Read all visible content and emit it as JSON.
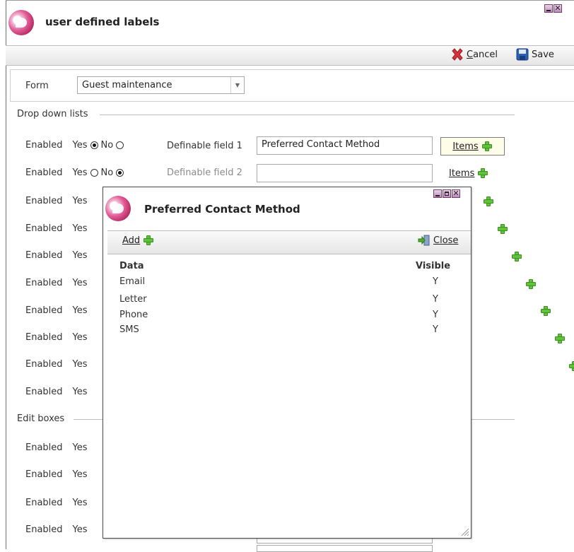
{
  "window": {
    "title": "user defined labels",
    "toolbar": {
      "cancel_label": "Cancel",
      "save_label": "Save"
    },
    "form_label": "Form",
    "form_value": "Guest maintenance",
    "section_dropdowns": "Drop down lists",
    "section_editboxes": "Edit boxes",
    "enabled_label": "Enabled",
    "yes_label": "Yes",
    "no_label": "No",
    "items_label": "Items",
    "rows": [
      {
        "field_label": "Definable field 1",
        "field_value": "Preferred Contact Method",
        "enabled": "yes"
      },
      {
        "field_label": "Definable field 2",
        "field_value": "",
        "enabled": "no"
      }
    ]
  },
  "dialog": {
    "title": "Preferred Contact Method",
    "add_label": "Add",
    "close_label": "Close",
    "columns": {
      "data": "Data",
      "visible": "Visible"
    },
    "items": [
      {
        "data": "Email",
        "visible": "Y"
      },
      {
        "data": "Letter",
        "visible": "Y"
      },
      {
        "data": "Phone",
        "visible": "Y"
      },
      {
        "data": "SMS",
        "visible": "Y"
      }
    ]
  },
  "colors": {
    "plus_green": "#5ec23a",
    "cancel_red": "#d9323a",
    "save_blue": "#2d5fb7"
  }
}
